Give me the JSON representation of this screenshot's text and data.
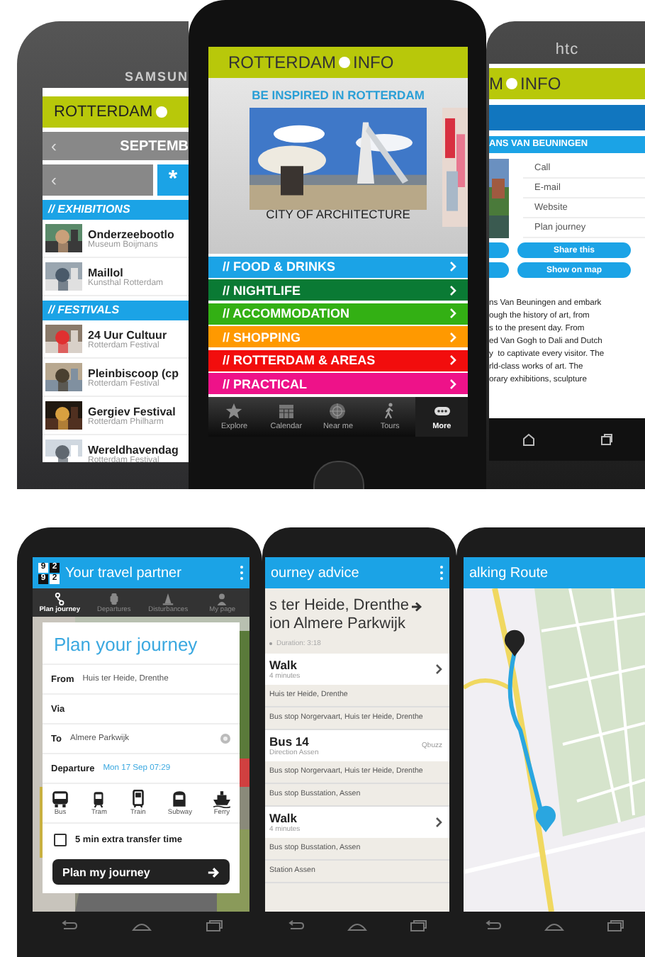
{
  "top_left_phone": {
    "brand": "SAMSUN",
    "app_title": "ROTTERDAM",
    "month_back": "‹",
    "month": "SEPTEMB",
    "day_back": "‹",
    "favorite": "*",
    "sections": [
      {
        "title": "// EXHIBITIONS",
        "items": [
          {
            "title": "Onderzeebootlo",
            "subtitle": "Museum Boijmans"
          },
          {
            "title": "Maillol",
            "subtitle": "Kunsthal Rotterdam"
          }
        ]
      },
      {
        "title": "// FESTIVALS",
        "items": [
          {
            "title": "24 Uur Cultuur",
            "subtitle": "Rotterdam Festival"
          },
          {
            "title": "Pleinbiscoop (cp",
            "subtitle": "Rotterdam Festival"
          },
          {
            "title": "Gergiev Festival",
            "subtitle": "Rotterdam Philharm"
          },
          {
            "title": "Wereldhavendag",
            "subtitle": "Rotterdam Festival"
          }
        ]
      }
    ]
  },
  "top_middle_phone": {
    "logo": [
      "ROTTERDAM",
      "INFO"
    ],
    "headline": "BE INSPIRED IN ROTTERDAM",
    "caption": "CITY OF ARCHITECTURE",
    "menu": [
      {
        "label": "// FOOD & DRINKS",
        "color": "#1ba3e6"
      },
      {
        "label": "// NIGHTLIFE",
        "color": "#0a7a34"
      },
      {
        "label": "// ACCOMMODATION",
        "color": "#33b014"
      },
      {
        "label": "// SHOPPING",
        "color": "#ff9900"
      },
      {
        "label": "// ROTTERDAM & AREAS",
        "color": "#f20d0d"
      },
      {
        "label": "// PRACTICAL",
        "color": "#ee1289"
      }
    ],
    "tabs": [
      {
        "kind": "star",
        "label": "Explore",
        "selected": false
      },
      {
        "kind": "calendar",
        "label": "Calendar",
        "selected": false
      },
      {
        "kind": "radar",
        "label": "Near me",
        "selected": false
      },
      {
        "kind": "walker",
        "label": "Tours",
        "selected": false
      },
      {
        "kind": "more",
        "label": "More",
        "selected": true
      }
    ]
  },
  "top_right_phone": {
    "brand": "htc",
    "logo": [
      "M",
      "INFO"
    ],
    "section": "ANS VAN BEUNINGEN",
    "actions": [
      "Call",
      "E-mail",
      "Website",
      "Plan journey"
    ],
    "buttons": [
      "Share this",
      "Show on map"
    ],
    "body": [
      "ns Van Beuningen and embark",
      "ough the history of art, from",
      "s to the present day. From",
      "ed Van Gogh to Dali and Dutch",
      "y  to captivate every visitor. The",
      "rld-class works of art. The",
      "orary exhibitions, sculpture"
    ]
  },
  "bottom_left_phone": {
    "logo": [
      "9",
      "2",
      "9",
      "2"
    ],
    "title": "Your travel partner",
    "tabs": [
      {
        "kind": "route",
        "label": "Plan journey",
        "selected": true
      },
      {
        "kind": "watch",
        "label": "Departures",
        "selected": false
      },
      {
        "kind": "cone",
        "label": "Disturbances",
        "selected": false
      },
      {
        "kind": "person",
        "label": "My page",
        "selected": false
      }
    ],
    "heading": "Plan your journey",
    "fields": [
      {
        "label": "From",
        "value": "Huis ter Heide, Drenthe",
        "locate": false
      },
      {
        "label": "Via",
        "locate": false
      },
      {
        "label": "To",
        "value": "Almere Parkwijk",
        "locate": true
      }
    ],
    "departure": {
      "label": "Departure",
      "value": "Mon 17 Sep 07:29"
    },
    "modes": [
      {
        "kind": "bus",
        "label": "Bus"
      },
      {
        "kind": "tram",
        "label": "Tram"
      },
      {
        "kind": "train",
        "label": "Train"
      },
      {
        "kind": "subway",
        "label": "Subway"
      },
      {
        "kind": "ferry",
        "label": "Ferry"
      }
    ],
    "transfer": {
      "label": "5 min extra transfer time",
      "checked": false
    },
    "button": "Plan my journey"
  },
  "bottom_middle_phone": {
    "title": "ourney advice",
    "route": [
      "s ter Heide, Drenthe",
      "ion Almere Parkwijk"
    ],
    "duration": "Duration: 3:18",
    "legs": [
      {
        "kind": "mode",
        "title": "Walk",
        "detail": "4 minutes",
        "chevron": true
      },
      {
        "kind": "stop",
        "text": "Huis ter Heide, Drenthe"
      },
      {
        "kind": "stop",
        "text": "Bus stop Norgervaart, Huis ter Heide, Drenthe"
      },
      {
        "kind": "mode",
        "title": "Bus 14",
        "detail": "Direction Assen",
        "operator": "Qbuzz",
        "chevron": false
      },
      {
        "kind": "stop",
        "text": "Bus stop Norgervaart, Huis ter Heide, Drenthe"
      },
      {
        "kind": "stop",
        "text": "Bus stop Busstation, Assen"
      },
      {
        "kind": "mode",
        "title": "Walk",
        "detail": "4 minutes",
        "chevron": true
      },
      {
        "kind": "stop",
        "text": "Bus stop Busstation, Assen"
      },
      {
        "kind": "stop",
        "text": "Station Assen"
      }
    ]
  },
  "bottom_right_phone": {
    "title": "alking Route"
  }
}
